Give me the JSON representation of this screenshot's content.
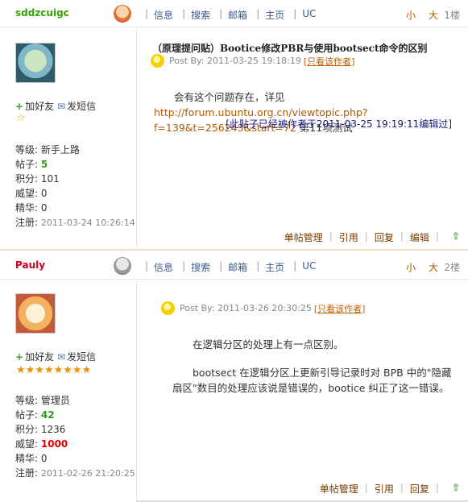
{
  "nav": [
    "信息",
    "搜索",
    "邮箱",
    "主页",
    "UC"
  ],
  "font_controls": {
    "small": "小",
    "large": "大"
  },
  "posts": [
    {
      "author": "sddzcuigc",
      "floor": "1楼",
      "actions": {
        "add_friend": "加好友",
        "send_message": "发短信"
      },
      "stars": "☆",
      "profile": {
        "level_label": "等级:",
        "level": "新手上路",
        "posts_label": "帖子:",
        "posts": "5",
        "points_label": "积分:",
        "points": "101",
        "prestige_label": "威望:",
        "prestige": "0",
        "elite_label": "精华:",
        "elite": "0",
        "registered_label": "注册:",
        "registered": "2011-03-24 10:26:14"
      },
      "title": "（原理提问贴）Bootice修改PBR与使用bootsect命令的区别",
      "meta": {
        "post_by": "Post By:",
        "time": "2011-03-25 19:18:19",
        "author_only": "[只看该作者]"
      },
      "body": {
        "text_before": "会有这个问题存在，详见",
        "link": "http://forum.ubuntu.org.cn/viewtopic.php?f=139&t=256243&start=72",
        "text_after": " 第11项测试"
      },
      "edited": "[此贴子已经被作者于2011-03-25 19:19:11编辑过]",
      "footer": {
        "manage": "单帖管理",
        "quote": "引用",
        "reply": "回复",
        "edit": "编辑"
      }
    },
    {
      "author": "Pauly",
      "floor": "2楼",
      "actions": {
        "add_friend": "加好友",
        "send_message": "发短信"
      },
      "stars": "★★★★★★★★",
      "profile": {
        "level_label": "等级:",
        "level": "管理员",
        "posts_label": "帖子:",
        "posts": "42",
        "points_label": "积分:",
        "points": "1236",
        "prestige_label": "威望:",
        "prestige": "1000",
        "elite_label": "精华:",
        "elite": "0",
        "registered_label": "注册:",
        "registered": "2011-02-26 21:20:25"
      },
      "meta": {
        "post_by": "Post By:",
        "time": "2011-03-26 20:30:25",
        "author_only": "[只看该作者]"
      },
      "body": {
        "p1": "在逻辑分区的处理上有一点区别。",
        "p2": "bootsect 在逻辑分区上更新引导记录时对 BPB 中的\"隐藏扇区\"数目的处理应该说是错误的，bootice 纠正了这一错误。"
      },
      "footer": {
        "manage": "单帖管理",
        "quote": "引用",
        "reply": "回复"
      }
    }
  ],
  "colors": {
    "author_1": "#35a300",
    "author_2": "#d0001c",
    "link": "#b05a00",
    "star": "#f09000"
  }
}
